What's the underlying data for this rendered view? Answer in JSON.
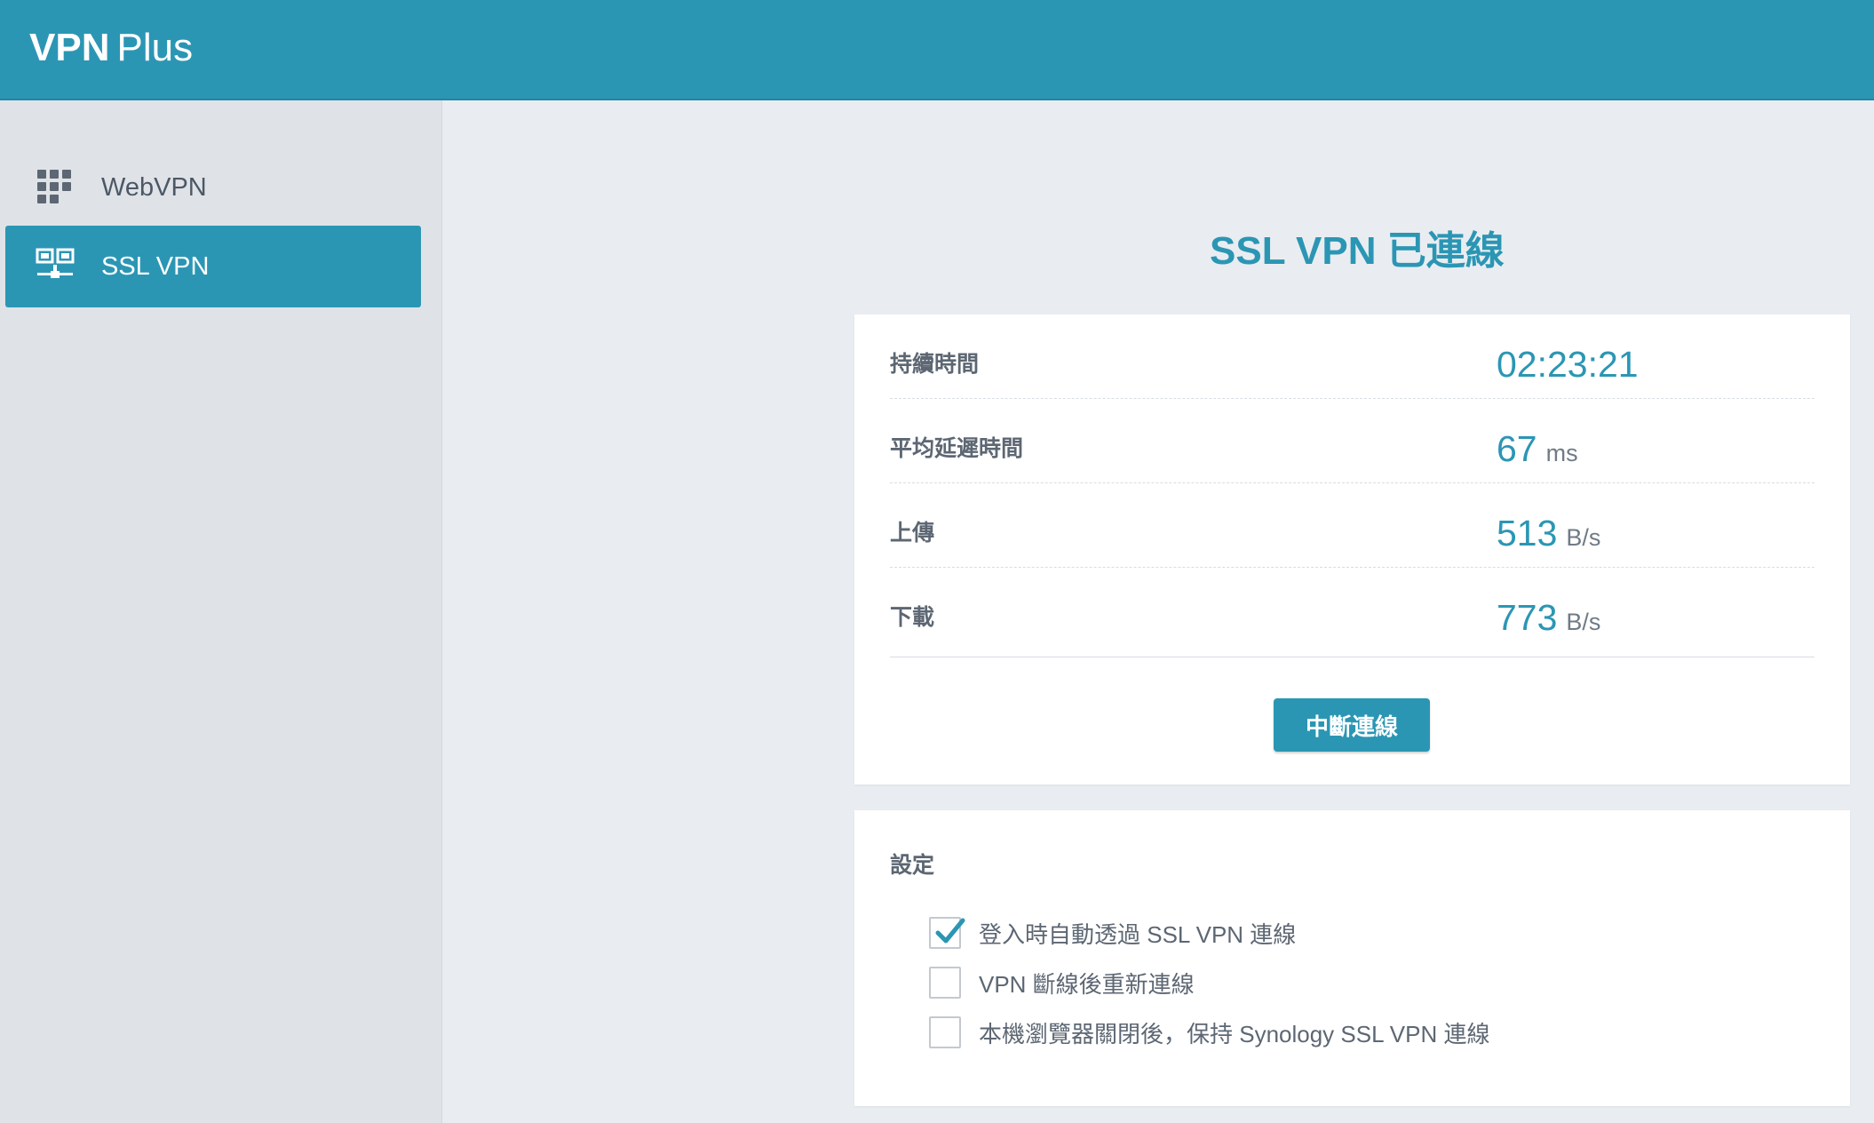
{
  "header": {
    "brand_bold": "VPN",
    "brand_light": "Plus"
  },
  "sidebar": {
    "items": [
      {
        "label": "WebVPN",
        "icon": "grid-icon",
        "active": false
      },
      {
        "label": "SSL VPN",
        "icon": "network-icon",
        "active": true
      }
    ]
  },
  "main": {
    "title": "SSL VPN 已連線",
    "status": {
      "rows": [
        {
          "label": "持續時間",
          "value": "02:23:21",
          "unit": ""
        },
        {
          "label": "平均延遲時間",
          "value": "67",
          "unit": "ms"
        },
        {
          "label": "上傳",
          "value": "513",
          "unit": "B/s"
        },
        {
          "label": "下載",
          "value": "773",
          "unit": "B/s"
        }
      ],
      "disconnect_label": "中斷連線"
    },
    "settings": {
      "title": "設定",
      "options": [
        {
          "label": "登入時自動透過 SSL VPN 連線",
          "checked": true
        },
        {
          "label": "VPN 斷線後重新連線",
          "checked": false
        },
        {
          "label": "本機瀏覽器關閉後，保持 Synology SSL VPN 連線",
          "checked": false
        }
      ]
    }
  },
  "colors": {
    "accent": "#2b96b4",
    "background": "#e9edf1",
    "sidebar": "#dfe3e8"
  }
}
